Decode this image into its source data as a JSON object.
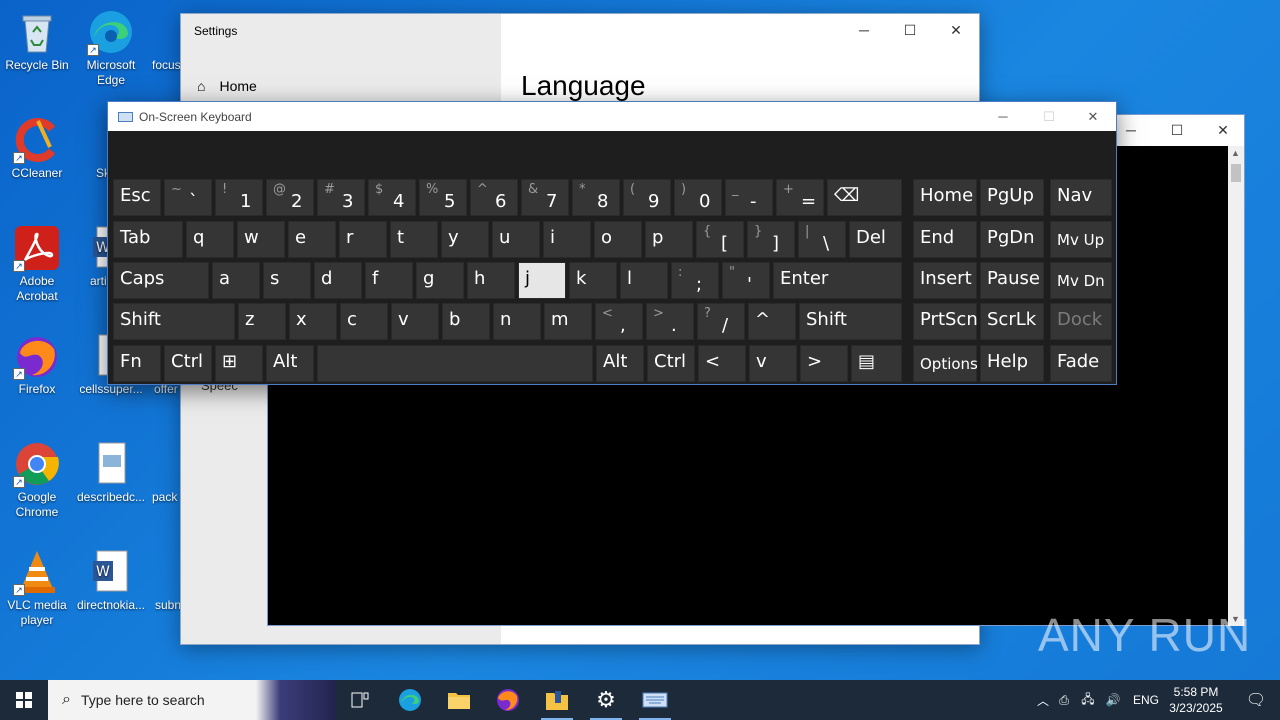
{
  "desktop": {
    "icons": [
      {
        "label": "Recycle Bin",
        "icon": "recycle-bin-icon"
      },
      {
        "label": "Microsoft Edge",
        "icon": "edge-icon"
      },
      {
        "label": "CCleaner",
        "icon": "ccleaner-icon"
      },
      {
        "label": "Adobe Acrobat",
        "icon": "acrobat-icon"
      },
      {
        "label": "Firefox",
        "icon": "firefox-icon"
      },
      {
        "label": "Google Chrome",
        "icon": "chrome-icon"
      },
      {
        "label": "VLC media player",
        "icon": "vlc-icon"
      }
    ],
    "second_column": [
      {
        "label": "article..."
      },
      {
        "label": "cellssuper..."
      },
      {
        "label": "describedc..."
      },
      {
        "label": "directnokia..."
      }
    ],
    "third_column": [
      {
        "label": "focus"
      },
      {
        "label": "Sk"
      },
      {
        "label": "offer"
      },
      {
        "label": "pack"
      },
      {
        "label": "subn"
      }
    ]
  },
  "settings": {
    "title": "Settings",
    "home": "Home",
    "heading": "Language",
    "partial_item": "Speec"
  },
  "osk": {
    "title": "On-Screen Keyboard",
    "rows": [
      [
        {
          "main": "Esc"
        },
        {
          "shifted": "~",
          "lower": "`"
        },
        {
          "shifted": "!",
          "lower": "1"
        },
        {
          "shifted": "@",
          "lower": "2"
        },
        {
          "shifted": "#",
          "lower": "3"
        },
        {
          "shifted": "$",
          "lower": "4"
        },
        {
          "shifted": "%",
          "lower": "5"
        },
        {
          "shifted": "^",
          "lower": "6"
        },
        {
          "shifted": "&",
          "lower": "7"
        },
        {
          "shifted": "*",
          "lower": "8"
        },
        {
          "shifted": "(",
          "lower": "9"
        },
        {
          "shifted": ")",
          "lower": "0"
        },
        {
          "shifted": "_",
          "lower": "-"
        },
        {
          "shifted": "+",
          "lower": "="
        },
        {
          "main": "⌫"
        }
      ],
      [
        {
          "main": "Tab"
        },
        {
          "main": "q"
        },
        {
          "main": "w"
        },
        {
          "main": "e"
        },
        {
          "main": "r"
        },
        {
          "main": "t"
        },
        {
          "main": "y"
        },
        {
          "main": "u"
        },
        {
          "main": "i"
        },
        {
          "main": "o"
        },
        {
          "main": "p"
        },
        {
          "shifted": "{",
          "lower": "["
        },
        {
          "shifted": "}",
          "lower": "]"
        },
        {
          "shifted": "|",
          "lower": "\\"
        },
        {
          "main": "Del"
        }
      ],
      [
        {
          "main": "Caps"
        },
        {
          "main": "a"
        },
        {
          "main": "s"
        },
        {
          "main": "d"
        },
        {
          "main": "f"
        },
        {
          "main": "g"
        },
        {
          "main": "h"
        },
        {
          "main": "j"
        },
        {
          "main": "k"
        },
        {
          "main": "l"
        },
        {
          "shifted": ":",
          "lower": ";"
        },
        {
          "shifted": "\"",
          "lower": "'"
        },
        {
          "main": "Enter"
        }
      ],
      [
        {
          "main": "Shift"
        },
        {
          "main": "z"
        },
        {
          "main": "x"
        },
        {
          "main": "c"
        },
        {
          "main": "v"
        },
        {
          "main": "b"
        },
        {
          "main": "n"
        },
        {
          "main": "m"
        },
        {
          "shifted": "<",
          "lower": ","
        },
        {
          "shifted": ">",
          "lower": "."
        },
        {
          "shifted": "?",
          "lower": "/"
        },
        {
          "main": "^"
        },
        {
          "main": "Shift"
        }
      ],
      [
        {
          "main": "Fn"
        },
        {
          "main": "Ctrl"
        },
        {
          "main": "⊞"
        },
        {
          "main": "Alt"
        },
        {
          "main": ""
        },
        {
          "main": "Alt"
        },
        {
          "main": "Ctrl"
        },
        {
          "main": "<"
        },
        {
          "main": "v"
        },
        {
          "main": ">"
        },
        {
          "main": "▤"
        }
      ]
    ],
    "nav_rows": [
      [
        {
          "main": "Home"
        },
        {
          "main": "PgUp"
        },
        {
          "main": "Nav"
        }
      ],
      [
        {
          "main": "End"
        },
        {
          "main": "PgDn"
        },
        {
          "main": "Mv Up"
        }
      ],
      [
        {
          "main": "Insert"
        },
        {
          "main": "Pause"
        },
        {
          "main": "Mv Dn"
        }
      ],
      [
        {
          "main": "PrtScn"
        },
        {
          "main": "ScrLk"
        },
        {
          "main": "Dock"
        }
      ],
      [
        {
          "main": "Options"
        },
        {
          "main": "Help"
        },
        {
          "main": "Fade"
        }
      ]
    ],
    "active_key": "j"
  },
  "taskbar": {
    "search_placeholder": "Type here to search",
    "tray_lang": "ENG",
    "time": "5:58 PM",
    "date": "3/23/2025"
  },
  "watermark": "ANY RUN",
  "colors": {
    "desktop": "#0f6fd0",
    "osk_bg": "#1e1e1e",
    "key_bg": "#353535",
    "key_active": "#e6e6e6",
    "taskbar": "#1c2a3a"
  }
}
